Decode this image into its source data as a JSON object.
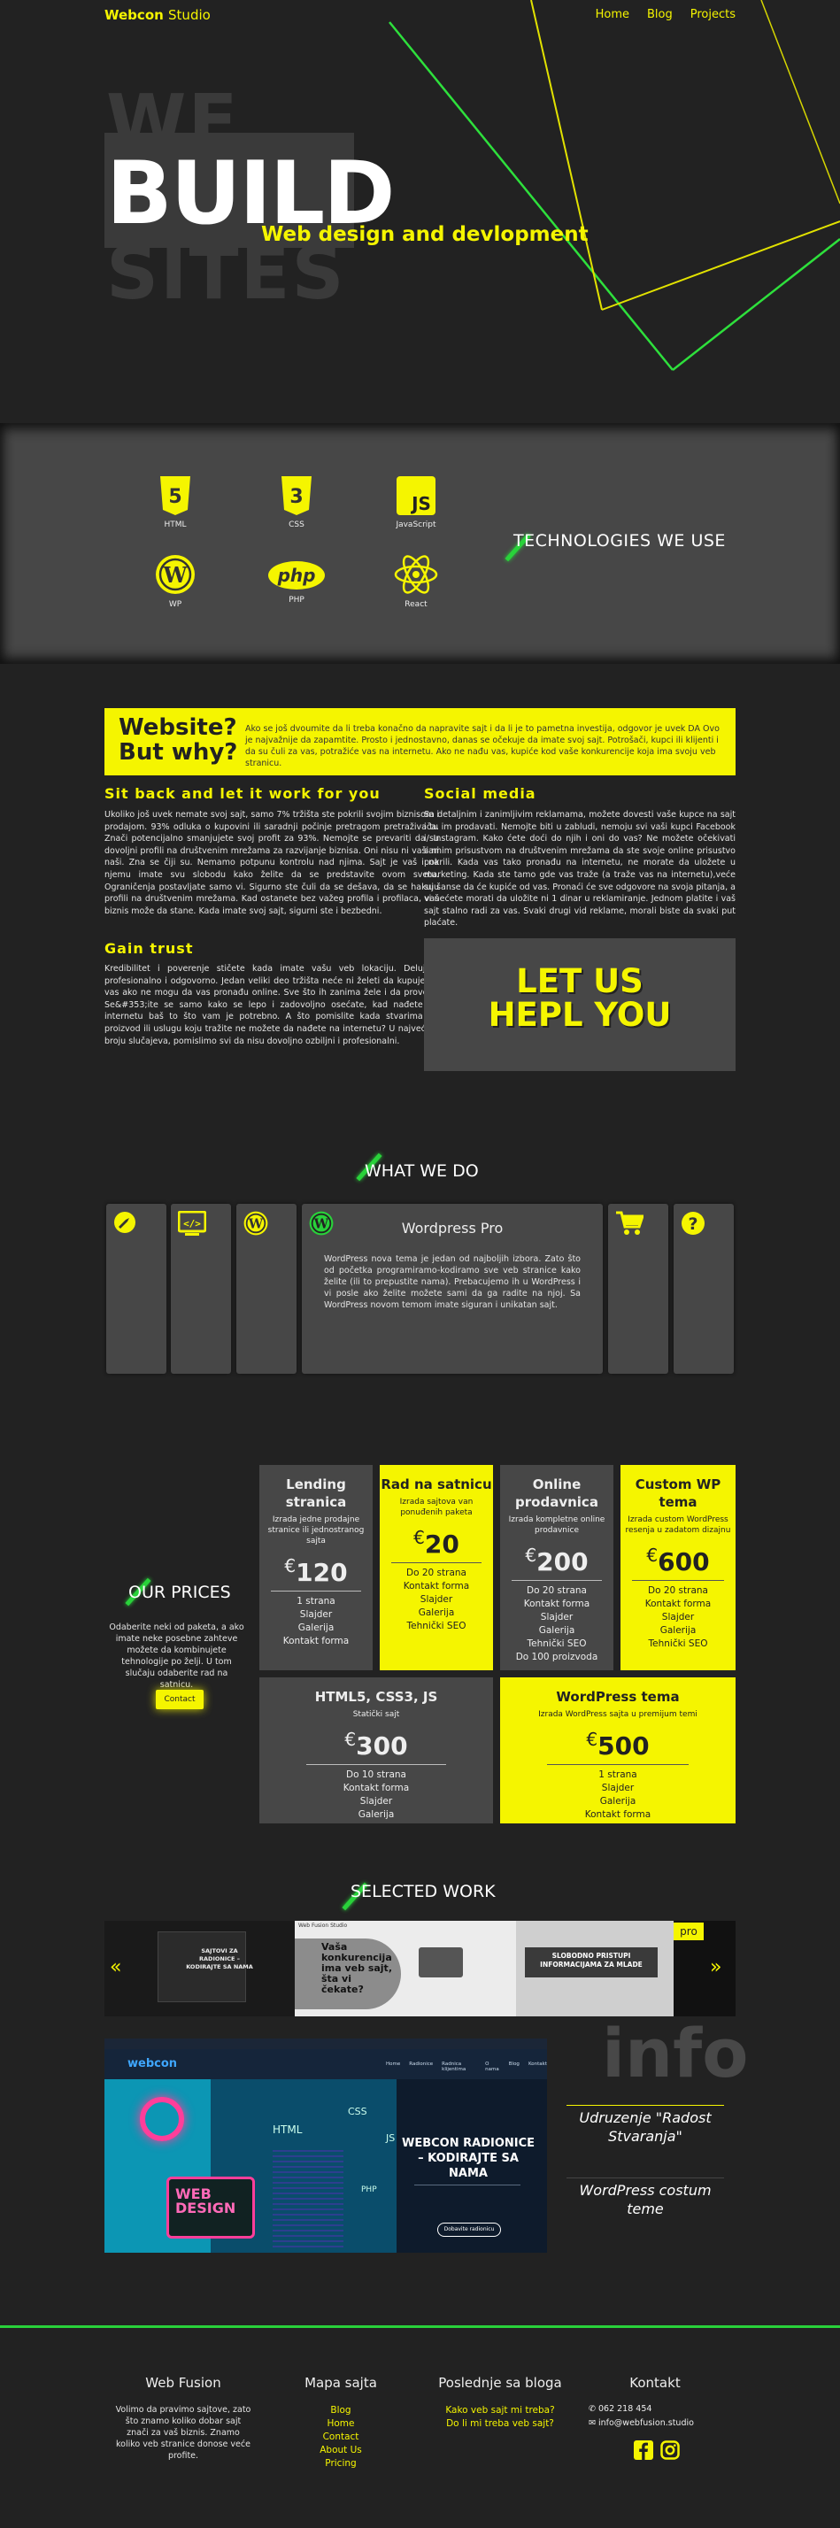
{
  "nav": {
    "brand": "Webcon",
    "brand_suffix": "Studio",
    "links": [
      "Home",
      "Blog",
      "Projects"
    ]
  },
  "hero": {
    "line1": "WE",
    "line2": "BUILD",
    "line3": "SITES",
    "subtitle": "Web design and devlopment"
  },
  "technologies": {
    "title": "TECHNOLOGIES WE USE",
    "items": [
      {
        "label": "HTML",
        "icon": "html5-icon",
        "glyph": "5"
      },
      {
        "label": "CSS",
        "icon": "css3-icon",
        "glyph": "3"
      },
      {
        "label": "JavaScript",
        "icon": "javascript-icon",
        "glyph": "JS"
      },
      {
        "label": "WP",
        "icon": "wordpress-icon",
        "glyph": "W"
      },
      {
        "label": "PHP",
        "icon": "php-icon",
        "glyph": "php"
      },
      {
        "label": "React",
        "icon": "react-icon",
        "glyph": "⚛"
      }
    ]
  },
  "why": {
    "title_line1": "Website?",
    "title_line2": "But why?",
    "text": "Ako se još dvoumite da li treba konačno da napravite sajt i da li je to pametna investija, odgovor je uvek DA Ovo je najvažnije da zapamtite. Prosto i jednostavno, danas se očekuje da imate svoj sajt. Potrošači, kupci ili klijenti i da su čuli za vas, potražiće vas na internetu. Ako ne nađu vas, kupiće kod vaše konkurencije koja ima svoju veb stranicu."
  },
  "sections": {
    "sit_back": {
      "title": "Sit back and let it work for you",
      "text": "Ukoliko još uvek nemate svoj sajt, samo 7% tržišta ste pokrili svojim biznisom i prodajom. 93% odluka o kupovini ili saradnji počinje pretragom pretraživača. Znači potencijalno smanjujete svoj profit za 93%. Nemojte se prevariti da su dovoljni profili na društvenim mrežama za razvijanje biznisa. Oni nisu ni vaši ni naši. Zna se čiji su. Nemamo potpunu kontrolu nad njima. Sajt je vaš i na njemu imate svu slobodu kako želite da se predstavite ovom svetu. Ograničenja postavljate samo vi. Sigurno ste čuli da se dešava, da se hakuju profili na društvenim mrežama. Kad ostanete bez važeg profila i profilaca, vaš biznis može da stane. Kada imate svoj sajt, sigurni ste i bezbedni."
    },
    "social": {
      "title": "Social media",
      "text": "Sa detaljnim i zanimljivim reklamama, možete dovesti vaše kupce na sajt i tu im prodavati. Nemojte biti u zabludi, nemoju svi vaši kupci Facebook i/ Instagram. Kako ćete doći do njih i oni do vas? Ne možete očekivati samim prisustvom na društvenim mrežama da ste svoje online prisustvo pokrili. Kada vas tako pronađu na internetu, ne morate da uložete u marketing. Kada ste tamo gde vas traže (a traže vas na internetu),veće su šanse da će kupiće od vas. Pronaći će sve odgovore na svoja pitanja, a vi nećete morati da uložite ni 1 dinar u reklamiranje. Jednom platite i vaš sajt stalno radi za vas. Svaki drugi vid reklame, morali biste da svaki put plaćate."
    },
    "gain_trust": {
      "title": "Gain trust",
      "text": "Kredibilitet i poverenje stičete kada imate vašu veb lokaciju. Delujete profesionalno i odgovorno. Jedan veliki deo tržišta neće ni želeti da kupuje od vas ako ne mogu da vas pronađu online. Sve što ih zanima žele i da provere. Se&#353;ite se samo kako se lepo i zadovoljno osećate, kad nađete na internetu baš to što vam je potrebno. A što pomislite kada stvarima do proizvod ili uslugu koju tražite ne možete da nađete na internetu? U najvećem broju slučajeva, pomislimo svi da nisu dovoljno ozbiljni i profesionalni."
    },
    "hepl": {
      "line1": "LET US",
      "line2": "HEPL YOU"
    }
  },
  "what_we_do": {
    "title": "WHAT WE DO",
    "cards": [
      {
        "icon": "rocket-icon"
      },
      {
        "icon": "code-window-icon"
      },
      {
        "icon": "wordpress-icon"
      },
      {
        "icon": "wordpress-icon",
        "title": "Wordpress Pro",
        "text": "WordPress nova tema je jedan od najboljih izbora. Zato što od početka programiramo-kodiramo sve veb stranice kako želite (ili to prepustite nama). Prebacujemo ih u WordPress i vi posle ako želite možete sami da ga radite na njoj. Sa WordPress novom temom imate siguran i unikatan sajt."
      },
      {
        "icon": "cart-icon"
      },
      {
        "icon": "question-icon"
      }
    ]
  },
  "prices": {
    "title": "OUR PRICES",
    "intro": "Odaberite neki od paketa, a ako imate neke posebne zahteve možete da kombinujete tehnologije po želji. U tom slučaju odaberite rad na satnicu.",
    "contact_label": "Contact",
    "currency": "€",
    "packages": [
      {
        "name": "Lending stranica",
        "desc": "Izrada jedne prodajne stranice ili jednostranog sajta",
        "price": "120",
        "items": [
          "1 strana",
          "Slajder",
          "Galerija",
          "Kontakt forma"
        ],
        "style": "dark"
      },
      {
        "name": "Rad na satnicu",
        "desc": "Izrada sajtova van ponuđenih paketa",
        "price": "20",
        "items": [
          "Do 20 strana",
          "Kontakt forma",
          "Slajder",
          "Galerija",
          "Tehnički SEO"
        ],
        "style": "yellow"
      },
      {
        "name": "Online prodavnica",
        "desc": "Izrada kompletne online prodavnice",
        "price": "200",
        "items": [
          "Do 20 strana",
          "Kontakt forma",
          "Slajder",
          "Galerija",
          "Tehnički SEO",
          "Do 100 proizvoda"
        ],
        "style": "dark"
      },
      {
        "name": "Custom WP tema",
        "desc": "Izrada custom WordPress resenja u zadatom dizajnu",
        "price": "600",
        "items": [
          "Do 20 strana",
          "Kontakt forma",
          "Slajder",
          "Galerija",
          "Tehnički SEO"
        ],
        "style": "yellow"
      },
      {
        "name": "HTML5, CSS3, JS",
        "desc": "Statički sajt",
        "price": "300",
        "items": [
          "Do 10 strana",
          "Kontakt forma",
          "Slajder",
          "Galerija"
        ],
        "style": "dark"
      },
      {
        "name": "WordPress tema",
        "desc": "Izrada WordPress sajta u premijum temi",
        "price": "500",
        "items": [
          "1 strana",
          "Slajder",
          "Galerija",
          "Kontakt forma"
        ],
        "style": "yellow"
      }
    ]
  },
  "selected_work": {
    "title": "SELECTED WORK",
    "slides": [
      {
        "caption": "SAJTOVI ZA RADIONICE – KODIRAJTE SA NAMA"
      },
      {
        "caption": "Vaša konkurencija ima veb sajt, šta vi čekate?",
        "logo": "Web Fusion Studio"
      },
      {
        "caption": "SLOBODNO PRISTUPI INFORMACIJAMA ZA MLADE"
      },
      {
        "caption": "pro"
      }
    ],
    "featured": {
      "site_logo": "webcon",
      "menu": [
        "Home",
        "Radionice",
        "Radnica klijentima",
        "O nama",
        "Blog",
        "Kontakt"
      ],
      "headline": "WEBCON RADIONICE – KODIRAJTE SA NAMA",
      "button": "Dobavite radionicu",
      "tags": [
        "HTML",
        "CSS",
        "JS",
        "PHP",
        "WEB DESIGN"
      ]
    },
    "info": {
      "bg": "info",
      "items": [
        "Udruzenje \"Radost Stvaranja\"",
        "WordPress costum teme"
      ]
    }
  },
  "footer": {
    "col1": {
      "title": "Web Fusion",
      "text": "Volimo da pravimo sajtove, zato što znamo koliko dobar sajt znači za vaš biznis. Znamo koliko veb stranice donose veće profite."
    },
    "col2": {
      "title": "Mapa sajta",
      "links": [
        "Blog",
        "Home",
        "Contact",
        "About Us",
        "Pricing"
      ]
    },
    "col3": {
      "title": "Poslednje sa bloga",
      "links": [
        "Kako veb sajt mi treba?",
        "Do li mi treba veb sajt?"
      ]
    },
    "col4": {
      "title": "Kontakt",
      "phone": "062 218 454",
      "email": "info@webfusion.studio"
    }
  },
  "colors": {
    "accent": "#f5f500",
    "green": "#29d23a",
    "bg": "#222222",
    "panel": "#474747"
  }
}
